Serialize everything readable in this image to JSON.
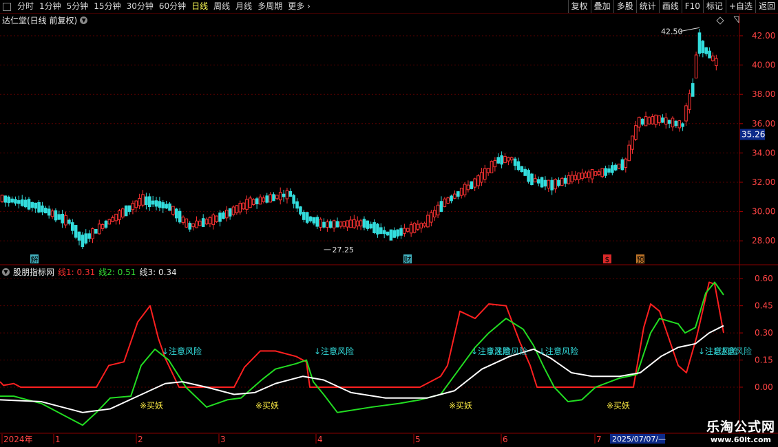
{
  "toolbar": {
    "periods": [
      "分时",
      "1分钟",
      "5分钟",
      "15分钟",
      "30分钟",
      "60分钟",
      "日线",
      "周线",
      "月线",
      "多周期",
      "更多"
    ],
    "active_period": "日线",
    "right_buttons": [
      "复权",
      "叠加",
      "多股",
      "统计",
      "画线",
      "F10",
      "标记",
      "+自选",
      "返回"
    ]
  },
  "stock": {
    "title": "达仁堂(日线 前复权)"
  },
  "price_axis": {
    "labels": [
      "42.00",
      "40.00",
      "38.00",
      "36.00",
      "34.00",
      "32.00",
      "30.00",
      "28.00"
    ],
    "current_price": "35.26"
  },
  "price_annotations": {
    "high": "42.50",
    "low": "27.25"
  },
  "event_markers": [
    {
      "label": "解",
      "color": "#4fd0e0"
    },
    {
      "label": "财",
      "color": "#4fd0e0"
    },
    {
      "label": "$",
      "color": "#ff3030"
    },
    {
      "label": "预",
      "color": "#e08a30"
    }
  ],
  "indicator": {
    "name": "股朋指标网",
    "line1_label": "线1: 0.31",
    "line2_label": "线2: 0.51",
    "line3_label": "线3: 0.34",
    "axis_labels": [
      "0.60",
      "0.45",
      "0.30",
      "0.15",
      "0.00"
    ],
    "risk_label": "↓注意风险",
    "buy_label": "※买妖",
    "overlap_label": "↓注意风险",
    "overlap_label2": "↓注意风险"
  },
  "time_axis": {
    "labels": [
      "2024年",
      "1",
      "2",
      "3",
      "4",
      "5",
      "6",
      "7"
    ],
    "cursor_date": "2025/07/07/—"
  },
  "watermark": {
    "line1": "乐淘公式网",
    "line2": "www.60lt.com"
  },
  "colors": {
    "up": "#ff3333",
    "down": "#33dddd",
    "line1": "#ff2020",
    "line2": "#22dd22",
    "line3": "#ffffff",
    "buy": "#ffee44",
    "risk": "#33dddd"
  }
}
